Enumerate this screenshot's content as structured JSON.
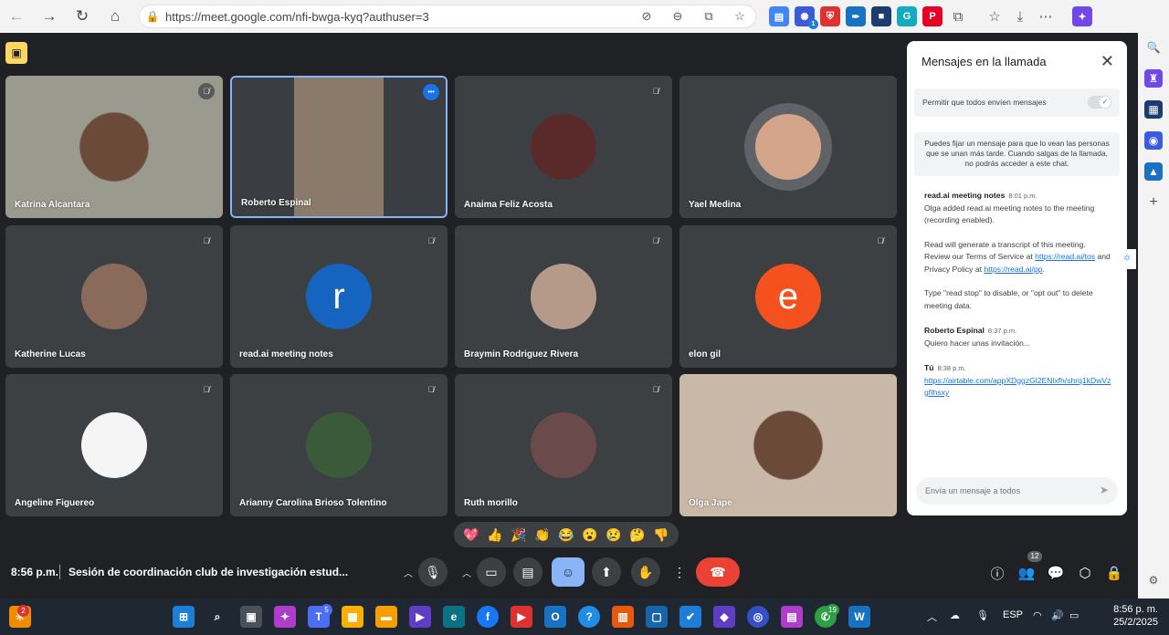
{
  "browser": {
    "url": "https://meet.google.com/nfi-bwga-kyq?authuser=3",
    "nav": {
      "back": "←",
      "forward": "→",
      "reload": "↻",
      "home": "⌂"
    },
    "url_icons": [
      "camera-off-icon",
      "zoom-out-icon",
      "app-icon",
      "star-icon"
    ],
    "extensions": [
      {
        "name": "docs-extension-icon",
        "color": "#4285f4",
        "glyph": "▤"
      },
      {
        "name": "puzzle-blue-extension-icon",
        "color": "#3b5bdb",
        "glyph": "✺"
      },
      {
        "name": "shield-extension-icon",
        "color": "#e03131",
        "glyph": "⛨"
      },
      {
        "name": "pen-extension-icon",
        "color": "#1971c2",
        "glyph": "✒"
      },
      {
        "name": "square-extension-icon",
        "color": "#1c3b6e",
        "glyph": "■"
      },
      {
        "name": "grammarly-extension-icon",
        "color": "#15aabf",
        "glyph": "G"
      },
      {
        "name": "pinterest-extension-icon",
        "color": "#e60023",
        "glyph": "P"
      },
      {
        "name": "extensions-icon",
        "color": "transparent",
        "glyph": "⧉"
      },
      {
        "name": "favorites-icon",
        "color": "transparent",
        "glyph": "☆"
      },
      {
        "name": "downloads-icon",
        "color": "transparent",
        "glyph": "⤓"
      },
      {
        "name": "more-icon",
        "color": "transparent",
        "glyph": "⋯"
      },
      {
        "name": "copilot-icon",
        "color": "#7048e8",
        "glyph": "✦"
      }
    ],
    "ext_badge": "1"
  },
  "meet": {
    "participants": [
      {
        "name": "Katrina Alcantara",
        "muted": true,
        "type": "video",
        "bg": "#9a9a8e"
      },
      {
        "name": "Roberto Espinal",
        "muted": false,
        "type": "video",
        "bg": "#3a3d41",
        "active": true
      },
      {
        "name": "Anaima Feliz Acosta",
        "muted": true,
        "type": "avatar",
        "bg": "#5a2a2a"
      },
      {
        "name": "Yael Medina",
        "muted": false,
        "type": "avatar-ring",
        "bg": "#d4a58a"
      },
      {
        "name": "Katherine Lucas",
        "muted": true,
        "type": "avatar",
        "bg": "#8a6a5a"
      },
      {
        "name": "read.ai meeting notes",
        "muted": true,
        "type": "letter",
        "letter": "r",
        "bg": "#1565c0"
      },
      {
        "name": "Braymin Rodriguez Rivera",
        "muted": true,
        "type": "avatar",
        "bg": "#b59a8a"
      },
      {
        "name": "elon gil",
        "muted": true,
        "type": "letter",
        "letter": "e",
        "bg": "#f4511e"
      },
      {
        "name": "Angeline Figuereo",
        "muted": true,
        "type": "avatar",
        "bg": "#f5f5f5"
      },
      {
        "name": "Arianny Carolina Brioso Tolentino",
        "muted": true,
        "type": "avatar",
        "bg": "#3a5a3a"
      },
      {
        "name": "Ruth morillo",
        "muted": true,
        "type": "avatar",
        "bg": "#6a4a4a"
      },
      {
        "name": "Olga Jape",
        "muted": false,
        "type": "video",
        "bg": "#c8b8a8"
      }
    ],
    "reactions": [
      "💖",
      "👍",
      "🎉",
      "👏",
      "😂",
      "😮",
      "😢",
      "🤔",
      "👎"
    ],
    "bottom": {
      "time": "8:56 p.m.",
      "title": "Sesión de coordinación club de investigación estud...",
      "people_count": "12"
    },
    "chat": {
      "title": "Mensajes en la llamada",
      "close": "✕",
      "allow_label": "Permitir que todos envíen mensajes",
      "pin_note": "Puedes fijar un mensaje para que lo vean las personas que se unan más tarde. Cuando salgas de la llamada, no podrás acceder a este chat.",
      "messages": [
        {
          "sender": "read.ai meeting notes",
          "time": "8:01 p.m.",
          "p1": "Olga added read.ai meeting notes to the meeting (recording enabled).",
          "p2a": "Read will generate a transcript of this meeting. Review our Terms of Service at ",
          "link1": "https://read.ai/tos",
          "p2b": " and Privacy Policy at ",
          "link2": "https://read.ai/pp",
          "p2c": ".",
          "p3": "Type \"read stop\" to disable, or \"opt out\" to delete meeting data."
        },
        {
          "sender": "Roberto Espinal",
          "time": "8:37 p.m.",
          "text": "Quiero hacer unas invitación..."
        },
        {
          "sender": "Tú",
          "time": "8:38 p.m.",
          "link": "https://airtable.com/appXDggzGl2ENlxfh/shrq1kDwVzgfIhsxy"
        }
      ],
      "input_placeholder": "Envía un mensaje a todos"
    }
  },
  "taskbar": {
    "weather_badge": "2",
    "teams_badge": "5",
    "whatsapp_badge": "19",
    "lang": "ESP",
    "time": "8:56 p. m.",
    "date": "25/2/2025"
  }
}
